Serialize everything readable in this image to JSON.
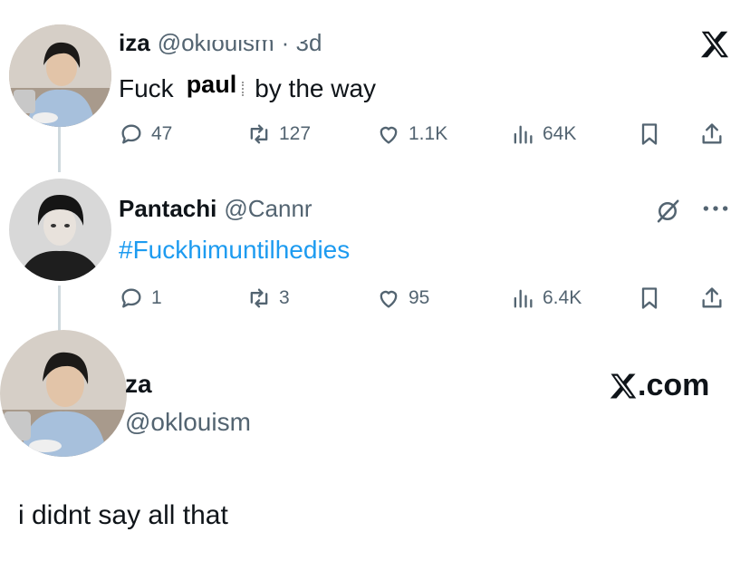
{
  "tweet1": {
    "name": "iza",
    "handle": "@oklouism",
    "time": "· 3d",
    "text_before": "Fuck",
    "redaction_label": "paul",
    "text_after": "by the way",
    "replies": "47",
    "retweets": "127",
    "likes": "1.1K",
    "views": "64K"
  },
  "tweet2": {
    "name": "Pantachi",
    "handle": "@Cannr",
    "text": "#Fuckhimuntilhedies",
    "replies": "1",
    "retweets": "3",
    "likes": "95",
    "views": "6.4K"
  },
  "reply": {
    "name": "za",
    "handle": "@oklouism",
    "brand": "X.com",
    "text": "i didnt say all that"
  },
  "colors": {
    "accent": "#1d9bf0",
    "muted": "#536471",
    "line": "#cfd9de"
  },
  "icons": [
    "x-logo-icon",
    "reply-icon",
    "retweet-icon",
    "like-icon",
    "views-icon",
    "bookmark-icon",
    "share-icon",
    "grok-icon",
    "more-icon"
  ]
}
